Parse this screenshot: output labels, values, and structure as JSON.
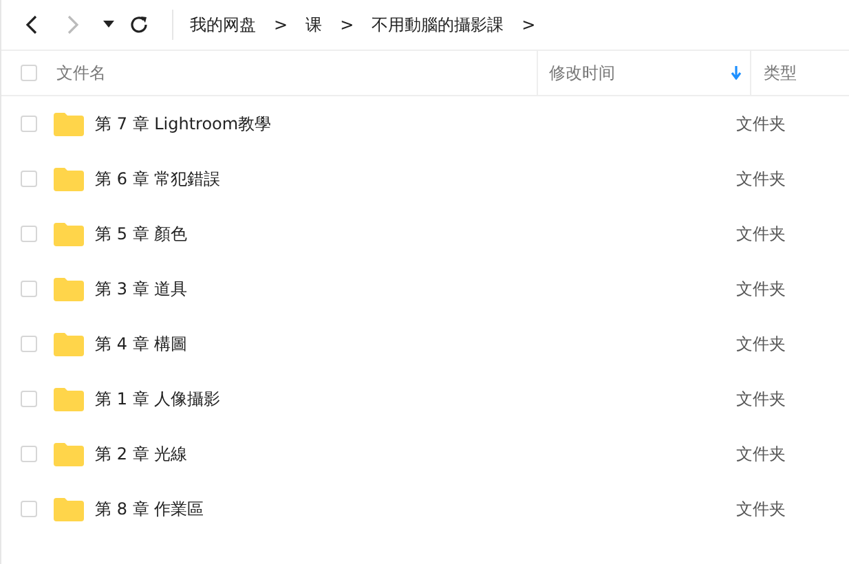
{
  "toolbar": {
    "back": {
      "disabled": false
    },
    "forward": {
      "disabled": true
    }
  },
  "breadcrumb": [
    {
      "label": "我的网盘"
    },
    {
      "label": "课"
    },
    {
      "label": "不用動腦的攝影課"
    }
  ],
  "breadcrumb_separator": ">",
  "table": {
    "columns": [
      {
        "label": "文件名",
        "sorted": false
      },
      {
        "label": "修改时间",
        "sorted": true
      },
      {
        "label": "类型",
        "sorted": false
      }
    ],
    "header_checked": false,
    "rows": [
      {
        "name": "第 7 章 Lightroom教學",
        "type": "文件夹",
        "checked": false
      },
      {
        "name": "第 6 章 常犯錯誤",
        "type": "文件夹",
        "checked": false
      },
      {
        "name": "第 5 章 顏色",
        "type": "文件夹",
        "checked": false
      },
      {
        "name": "第 3 章 道具",
        "type": "文件夹",
        "checked": false
      },
      {
        "name": "第 4 章 構圖",
        "type": "文件夹",
        "checked": false
      },
      {
        "name": "第 1 章 人像攝影",
        "type": "文件夹",
        "checked": false
      },
      {
        "name": "第 2 章 光線",
        "type": "文件夹",
        "checked": false
      },
      {
        "name": "第 8 章 作業區",
        "type": "文件夹",
        "checked": false
      }
    ]
  }
}
